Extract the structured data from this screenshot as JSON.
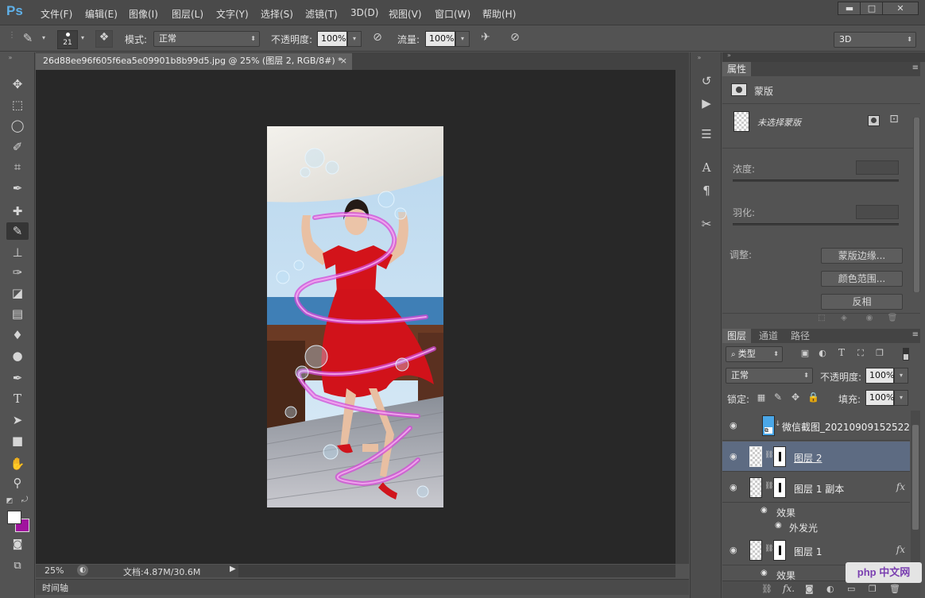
{
  "app": {
    "logo": "Ps",
    "menu": [
      "文件(F)",
      "编辑(E)",
      "图像(I)",
      "图层(L)",
      "文字(Y)",
      "选择(S)",
      "滤镜(T)",
      "3D(D)",
      "视图(V)",
      "窗口(W)",
      "帮助(H)"
    ],
    "window_buttons": {
      "minimize": "▬",
      "maximize": "□",
      "close": "✕"
    }
  },
  "options": {
    "brush_size": "21",
    "mode_label": "模式:",
    "mode_value": "正常",
    "opacity_label": "不透明度:",
    "opacity_value": "100%",
    "flow_label": "流量:",
    "flow_value": "100%",
    "workspace": "3D"
  },
  "document": {
    "tab_title": "26d88ee96f605f6ea5e09901b8b99d5.jpg @ 25% (图层 2, RGB/8#) *",
    "tab_close": "×",
    "zoom": "25%",
    "doc_size": "文档:4.87M/30.6M",
    "timeline_label": "时间轴"
  },
  "properties": {
    "tab": "属性",
    "mask_title": "蒙版",
    "no_mask_selected": "未选择蒙版",
    "density_label": "浓度:",
    "feather_label": "羽化:",
    "adjust_label": "调整:",
    "btn_mask_edge": "蒙版边缘...",
    "btn_color_range": "颜色范围...",
    "btn_invert": "反相"
  },
  "layers_panel": {
    "tabs": [
      "图层",
      "通道",
      "路径"
    ],
    "filter_kind": "类型",
    "blend_mode": "正常",
    "opacity_label": "不透明度:",
    "opacity_value": "100%",
    "lock_label": "锁定:",
    "fill_label": "填充:",
    "fill_value": "100%",
    "layers": [
      {
        "name": "微信截图_20210909152522",
        "fx": ""
      },
      {
        "name": "图层 2",
        "fx": ""
      },
      {
        "name": "图层 1 副本",
        "fx": "fx"
      },
      {
        "name": "图层 1",
        "fx": "fx"
      }
    ],
    "effect_label": "效果",
    "outer_glow": "外发光",
    "effect_label_2": "效果"
  },
  "watermark": "php 中文网",
  "colors": {
    "foreground": "#ffffff",
    "background": "#a0139e",
    "selection": "#5d6b82"
  }
}
